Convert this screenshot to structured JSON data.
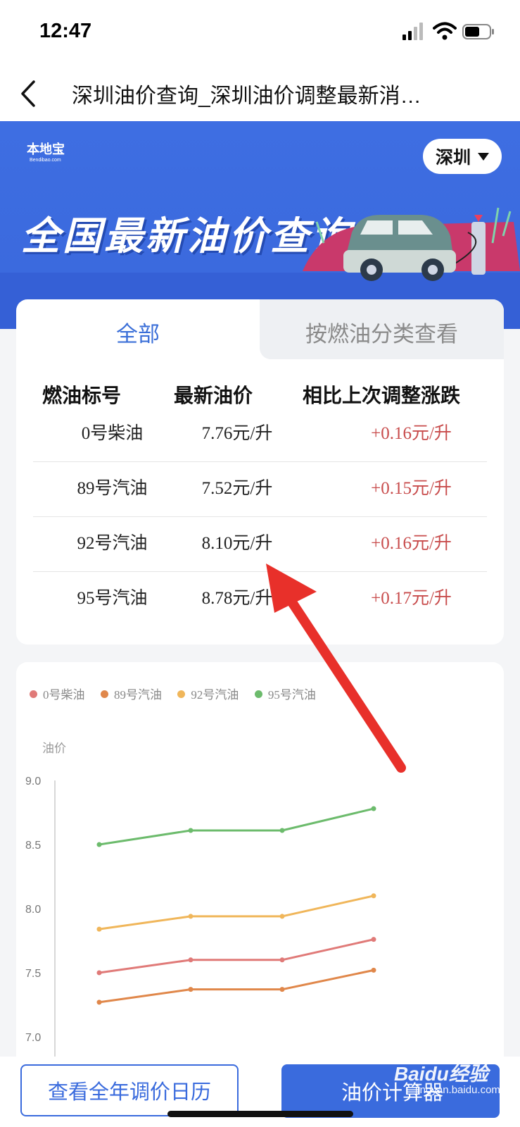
{
  "status": {
    "time": "12:47"
  },
  "nav": {
    "title": "深圳油价查询_深圳油价调整最新消…"
  },
  "banner": {
    "logo": "本地宝",
    "logo_sub": "Bendibao.com",
    "city": "深圳",
    "title": "全国最新油价查询"
  },
  "tabs": [
    {
      "label": "全部",
      "active": true
    },
    {
      "label": "按燃油分类查看",
      "active": false
    }
  ],
  "table": {
    "headers": [
      "燃油标号",
      "最新油价",
      "相比上次调整涨跌"
    ],
    "rows": [
      [
        "0号柴油",
        "7.76元/升",
        "+0.16元/升"
      ],
      [
        "89号汽油",
        "7.52元/升",
        "+0.15元/升"
      ],
      [
        "92号汽油",
        "8.10元/升",
        "+0.16元/升"
      ],
      [
        "95号汽油",
        "8.78元/升",
        "+0.17元/升"
      ]
    ]
  },
  "chart_data": {
    "type": "line",
    "ylabel": "油价",
    "ylim": [
      7.0,
      9.0
    ],
    "y_ticks": [
      "9.0",
      "8.5",
      "8.0",
      "7.5",
      "7.0"
    ],
    "grid": false,
    "legend": "top-left",
    "series": [
      {
        "name": "0号柴油",
        "color": "#e07a78",
        "values": [
          7.5,
          7.6,
          7.6,
          7.76
        ]
      },
      {
        "name": "89号汽油",
        "color": "#e0874a",
        "values": [
          7.27,
          7.37,
          7.37,
          7.52
        ]
      },
      {
        "name": "92号汽油",
        "color": "#f0b65a",
        "values": [
          7.84,
          7.94,
          7.94,
          8.1
        ]
      },
      {
        "name": "95号汽油",
        "color": "#6cbb6c",
        "values": [
          8.5,
          8.61,
          8.61,
          8.78
        ]
      }
    ]
  },
  "bottom": {
    "calendar_button": "查看全年调价日历",
    "calc_button": "油价计算器",
    "watermark": "Baidu经验",
    "watermark_url": "jingyan.baidu.com"
  },
  "colors": {
    "accent": "#3a6bdd",
    "rise": "#c84c4c",
    "arrow": "#e8302a"
  }
}
